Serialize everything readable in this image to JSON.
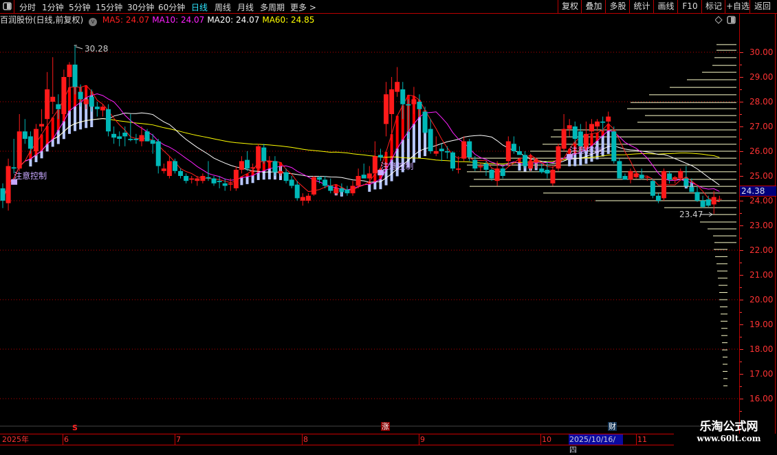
{
  "toolbar": {
    "periods": [
      {
        "label": "分时",
        "x": 28
      },
      {
        "label": "1分钟",
        "x": 61
      },
      {
        "label": "5分钟",
        "x": 100
      },
      {
        "label": "15分钟",
        "x": 139
      },
      {
        "label": "30分钟",
        "x": 185
      },
      {
        "label": "60分钟",
        "x": 230
      },
      {
        "label": "日线",
        "x": 278,
        "active": true
      },
      {
        "label": "周线",
        "x": 312
      },
      {
        "label": "月线",
        "x": 345
      },
      {
        "label": "多周期",
        "x": 378
      },
      {
        "label": "更多 >",
        "x": 422
      }
    ],
    "actions": [
      "复权",
      "叠加",
      "多股",
      "统计",
      "画线",
      "F10",
      "标记",
      "+自选",
      "返回"
    ]
  },
  "info": {
    "title": "百润股份(日线,前复权)",
    "ma": [
      {
        "label": "MA5: 24.07",
        "color": "#ff2020"
      },
      {
        "label": "MA10: 24.07",
        "color": "#ff20ff"
      },
      {
        "label": "MA20: 24.07",
        "color": "#ffffff"
      },
      {
        "label": "MA60: 24.85",
        "color": "#ffff00"
      }
    ]
  },
  "colors": {
    "up": "#ff1a1a",
    "down": "#00b8b8",
    "ma5": "#ff2020",
    "ma10": "#ff20ff",
    "ma20": "#ffffff",
    "ma60": "#ffff00",
    "grid": "#c00000",
    "chips": "#ffffcc",
    "fill_up": "#ff0000",
    "fill_base": "#b8c8ff"
  },
  "axis": {
    "labels": [
      "30.00",
      "29.00",
      "28.00",
      "27.00",
      "26.00",
      "25.00",
      "24.00",
      "23.00",
      "22.00",
      "21.00",
      "20.00",
      "19.00",
      "18.00",
      "17.00",
      "16.00"
    ],
    "current_price": "24.38"
  },
  "annotations": {
    "high_label": "30.28",
    "low_label": "23.47",
    "signal_text": "注意控制"
  },
  "dates": {
    "year": "2025年",
    "months": [
      "6",
      "7",
      "8",
      "9",
      "10",
      "11"
    ],
    "selected": "2025/10/16/四"
  },
  "markers": {
    "s": "S",
    "zhang": "涨",
    "cai": "财"
  },
  "watermark": {
    "name": "乐淘公式网",
    "url": "www.60lt.com"
  },
  "chart_data": {
    "type": "candlestick",
    "ylim": [
      16,
      30.3
    ],
    "candles": [
      [
        24.5,
        24.7,
        23.7,
        24.0
      ],
      [
        23.9,
        25.7,
        23.6,
        25.4
      ],
      [
        25.35,
        26.5,
        25.1,
        25.3
      ],
      [
        25.3,
        27.5,
        25.2,
        26.8
      ],
      [
        26.8,
        27.3,
        26.3,
        26.5
      ],
      [
        26.6,
        26.8,
        25.9,
        26.1
      ],
      [
        26.0,
        27.1,
        25.8,
        26.9
      ],
      [
        27.0,
        27.7,
        26.8,
        27.1
      ],
      [
        27.3,
        29.2,
        27.0,
        28.5
      ],
      [
        28.0,
        29.8,
        27.5,
        28.2
      ],
      [
        27.9,
        28.3,
        27.3,
        27.7
      ],
      [
        27.5,
        29.3,
        27.3,
        29.0
      ],
      [
        29.0,
        29.6,
        28.4,
        29.5
      ],
      [
        29.5,
        30.28,
        28.3,
        28.6
      ],
      [
        28.4,
        28.7,
        27.8,
        28.1
      ],
      [
        27.9,
        28.5,
        27.7,
        28.1
      ],
      [
        28.2,
        28.5,
        27.6,
        27.8
      ],
      [
        27.8,
        28.0,
        27.4,
        27.7
      ],
      [
        27.65,
        27.9,
        27.4,
        27.8
      ],
      [
        27.7,
        27.9,
        26.6,
        26.8
      ],
      [
        26.7,
        27.0,
        26.3,
        26.55
      ],
      [
        26.6,
        26.8,
        26.2,
        26.5
      ],
      [
        26.75,
        27.0,
        26.2,
        26.6
      ],
      [
        26.5,
        27.5,
        26.4,
        26.45
      ],
      [
        26.5,
        26.7,
        26.3,
        26.45
      ],
      [
        26.4,
        27.0,
        26.2,
        26.65
      ],
      [
        26.8,
        26.9,
        26.4,
        26.4
      ],
      [
        26.45,
        26.7,
        25.9,
        26.3
      ],
      [
        26.4,
        26.5,
        25.1,
        25.4
      ],
      [
        25.2,
        25.5,
        25.1,
        25.3
      ],
      [
        25.0,
        25.8,
        24.9,
        25.6
      ],
      [
        25.6,
        25.7,
        25.1,
        25.2
      ],
      [
        25.2,
        25.3,
        24.9,
        25.0
      ],
      [
        25.0,
        25.1,
        24.7,
        24.8
      ],
      [
        24.85,
        25.0,
        24.7,
        24.9
      ],
      [
        24.8,
        25.0,
        24.6,
        24.9
      ],
      [
        24.8,
        25.1,
        24.7,
        25.0
      ],
      [
        24.95,
        25.6,
        24.8,
        24.9
      ],
      [
        24.9,
        25.0,
        24.6,
        24.7
      ],
      [
        24.8,
        25.0,
        24.5,
        24.75
      ],
      [
        24.7,
        24.9,
        24.4,
        24.6
      ],
      [
        24.65,
        24.9,
        24.4,
        24.7
      ],
      [
        24.5,
        25.4,
        24.4,
        25.25
      ],
      [
        25.25,
        25.8,
        25.1,
        25.6
      ],
      [
        25.65,
        26.0,
        25.2,
        25.3
      ],
      [
        25.3,
        25.5,
        25.1,
        25.35
      ],
      [
        25.3,
        26.3,
        25.2,
        26.2
      ],
      [
        26.15,
        26.3,
        25.5,
        25.6
      ],
      [
        25.55,
        25.8,
        25.4,
        25.6
      ],
      [
        25.6,
        25.8,
        25.0,
        25.15
      ],
      [
        25.1,
        25.4,
        25.0,
        25.2
      ],
      [
        25.15,
        25.3,
        24.7,
        24.8
      ],
      [
        24.85,
        25.0,
        24.5,
        24.6
      ],
      [
        24.65,
        24.8,
        24.0,
        24.1
      ],
      [
        24.0,
        24.3,
        23.8,
        24.15
      ],
      [
        24.0,
        24.3,
        23.9,
        24.2
      ],
      [
        24.25,
        25.0,
        24.2,
        24.95
      ],
      [
        24.95,
        25.0,
        24.7,
        24.85
      ],
      [
        24.85,
        25.0,
        24.5,
        24.6
      ],
      [
        24.6,
        24.9,
        24.3,
        24.4
      ],
      [
        24.3,
        24.6,
        24.2,
        24.5
      ],
      [
        24.5,
        24.7,
        24.2,
        24.35
      ],
      [
        24.45,
        24.6,
        24.2,
        24.3
      ],
      [
        24.3,
        24.8,
        24.2,
        24.6
      ],
      [
        24.6,
        25.3,
        24.5,
        25.0
      ],
      [
        25.05,
        25.5,
        24.9,
        24.9
      ],
      [
        24.9,
        25.4,
        24.8,
        25.1
      ],
      [
        25.1,
        26.4,
        25.0,
        25.8
      ],
      [
        25.85,
        26.1,
        25.6,
        25.75
      ],
      [
        27.1,
        28.8,
        26.6,
        28.3
      ],
      [
        27.5,
        29.0,
        26.4,
        28.5
      ],
      [
        28.4,
        29.4,
        28.2,
        28.8
      ],
      [
        28.5,
        28.8,
        27.3,
        27.9
      ],
      [
        27.9,
        28.1,
        26.5,
        27.85
      ],
      [
        27.9,
        28.6,
        27.5,
        28.1
      ],
      [
        28.0,
        28.3,
        27.4,
        27.7
      ],
      [
        27.6,
        27.8,
        26.7,
        26.75
      ],
      [
        26.9,
        27.3,
        25.9,
        26.0
      ],
      [
        25.9,
        26.6,
        25.8,
        26.0
      ],
      [
        26.1,
        26.3,
        25.6,
        26.0
      ],
      [
        26.0,
        26.2,
        25.7,
        25.95
      ],
      [
        25.95,
        26.0,
        25.2,
        25.3
      ],
      [
        25.25,
        25.8,
        25.1,
        25.3
      ],
      [
        25.7,
        26.6,
        25.6,
        26.4
      ],
      [
        26.4,
        26.5,
        25.6,
        25.75
      ],
      [
        25.65,
        25.8,
        25.2,
        25.3
      ],
      [
        25.35,
        25.5,
        25.2,
        25.4
      ],
      [
        25.5,
        25.6,
        25.0,
        25.25
      ],
      [
        25.25,
        25.3,
        24.8,
        24.9
      ],
      [
        24.8,
        25.6,
        24.6,
        25.3
      ],
      [
        25.3,
        25.4,
        24.9,
        25.0
      ],
      [
        25.6,
        26.6,
        25.4,
        26.4
      ],
      [
        26.3,
        26.6,
        25.9,
        26.0
      ],
      [
        26.0,
        26.2,
        25.9,
        25.85
      ],
      [
        25.85,
        26.0,
        25.3,
        25.4
      ],
      [
        25.3,
        25.9,
        25.2,
        25.6
      ],
      [
        25.55,
        25.7,
        25.3,
        25.65
      ],
      [
        25.3,
        25.5,
        25.1,
        25.15
      ],
      [
        25.25,
        25.6,
        24.9,
        25.1
      ],
      [
        24.7,
        25.4,
        24.6,
        25.25
      ],
      [
        25.3,
        26.3,
        25.2,
        26.2
      ],
      [
        26.1,
        27.5,
        26.0,
        26.9
      ],
      [
        26.9,
        27.3,
        26.6,
        27.05
      ],
      [
        27.0,
        27.2,
        26.3,
        26.5
      ],
      [
        26.8,
        27.1,
        25.9,
        26.2
      ],
      [
        26.1,
        27.2,
        26.0,
        26.7
      ],
      [
        26.8,
        27.3,
        26.5,
        27.1
      ],
      [
        27.0,
        27.3,
        26.8,
        27.2
      ],
      [
        27.2,
        27.4,
        26.8,
        27.15
      ],
      [
        27.2,
        27.6,
        26.9,
        27.4
      ],
      [
        26.8,
        27.0,
        25.5,
        25.6
      ],
      [
        25.6,
        25.7,
        24.9,
        24.9
      ],
      [
        25.0,
        25.1,
        24.85,
        24.85
      ],
      [
        24.85,
        25.3,
        24.7,
        25.2
      ],
      [
        24.95,
        25.2,
        24.9,
        25.1
      ],
      [
        25.05,
        25.3,
        24.85,
        24.9
      ],
      [
        24.95,
        25.0,
        24.8,
        24.95
      ],
      [
        24.8,
        24.9,
        24.1,
        24.2
      ],
      [
        24.2,
        24.3,
        23.9,
        24.0
      ],
      [
        24.1,
        25.3,
        24.0,
        25.2
      ],
      [
        25.1,
        25.2,
        24.7,
        24.85
      ],
      [
        24.85,
        25.0,
        24.7,
        24.95
      ],
      [
        24.9,
        25.3,
        24.8,
        25.2
      ],
      [
        24.9,
        25.4,
        24.5,
        24.6
      ],
      [
        24.55,
        24.9,
        24.4,
        24.35
      ],
      [
        24.35,
        24.6,
        23.95,
        24.0
      ],
      [
        24.0,
        24.2,
        23.7,
        23.75
      ],
      [
        24.05,
        24.2,
        23.75,
        23.8
      ],
      [
        23.85,
        24.4,
        23.47,
        24.15
      ],
      [
        24.05,
        24.2,
        23.95,
        24.07
      ]
    ],
    "signal_candle_indices": [
      1,
      67,
      101
    ],
    "chip_distribution": [
      [
        30.31,
        29
      ],
      [
        30.08,
        29
      ],
      [
        29.78,
        32
      ],
      [
        29.47,
        35
      ],
      [
        29.19,
        50
      ],
      [
        28.89,
        72
      ],
      [
        28.58,
        97
      ],
      [
        28.28,
        127
      ],
      [
        27.97,
        154
      ],
      [
        27.72,
        159
      ],
      [
        27.44,
        133
      ],
      [
        27.17,
        144
      ],
      [
        26.86,
        266
      ],
      [
        26.58,
        270
      ],
      [
        26.28,
        282
      ],
      [
        26.0,
        300
      ],
      [
        25.72,
        390
      ],
      [
        25.44,
        392
      ],
      [
        25.17,
        392
      ],
      [
        24.86,
        382
      ],
      [
        24.58,
        388
      ],
      [
        24.31,
        281
      ],
      [
        24.0,
        205
      ],
      [
        23.72,
        105
      ],
      [
        23.44,
        52
      ],
      [
        23.14,
        53
      ],
      [
        22.86,
        42
      ],
      [
        22.58,
        34
      ],
      [
        22.31,
        32
      ],
      [
        22.03,
        20
      ],
      [
        21.74,
        18
      ],
      [
        21.45,
        16
      ],
      [
        21.16,
        15
      ],
      [
        20.87,
        14
      ],
      [
        20.58,
        13
      ],
      [
        20.29,
        12
      ],
      [
        20.0,
        12
      ],
      [
        19.71,
        11
      ],
      [
        19.42,
        10
      ],
      [
        19.13,
        10
      ],
      [
        18.84,
        9
      ],
      [
        18.55,
        9
      ],
      [
        18.26,
        8
      ],
      [
        17.97,
        8
      ],
      [
        17.68,
        7
      ],
      [
        17.39,
        7
      ],
      [
        17.1,
        7
      ],
      [
        16.81,
        6
      ],
      [
        16.52,
        6
      ]
    ]
  }
}
